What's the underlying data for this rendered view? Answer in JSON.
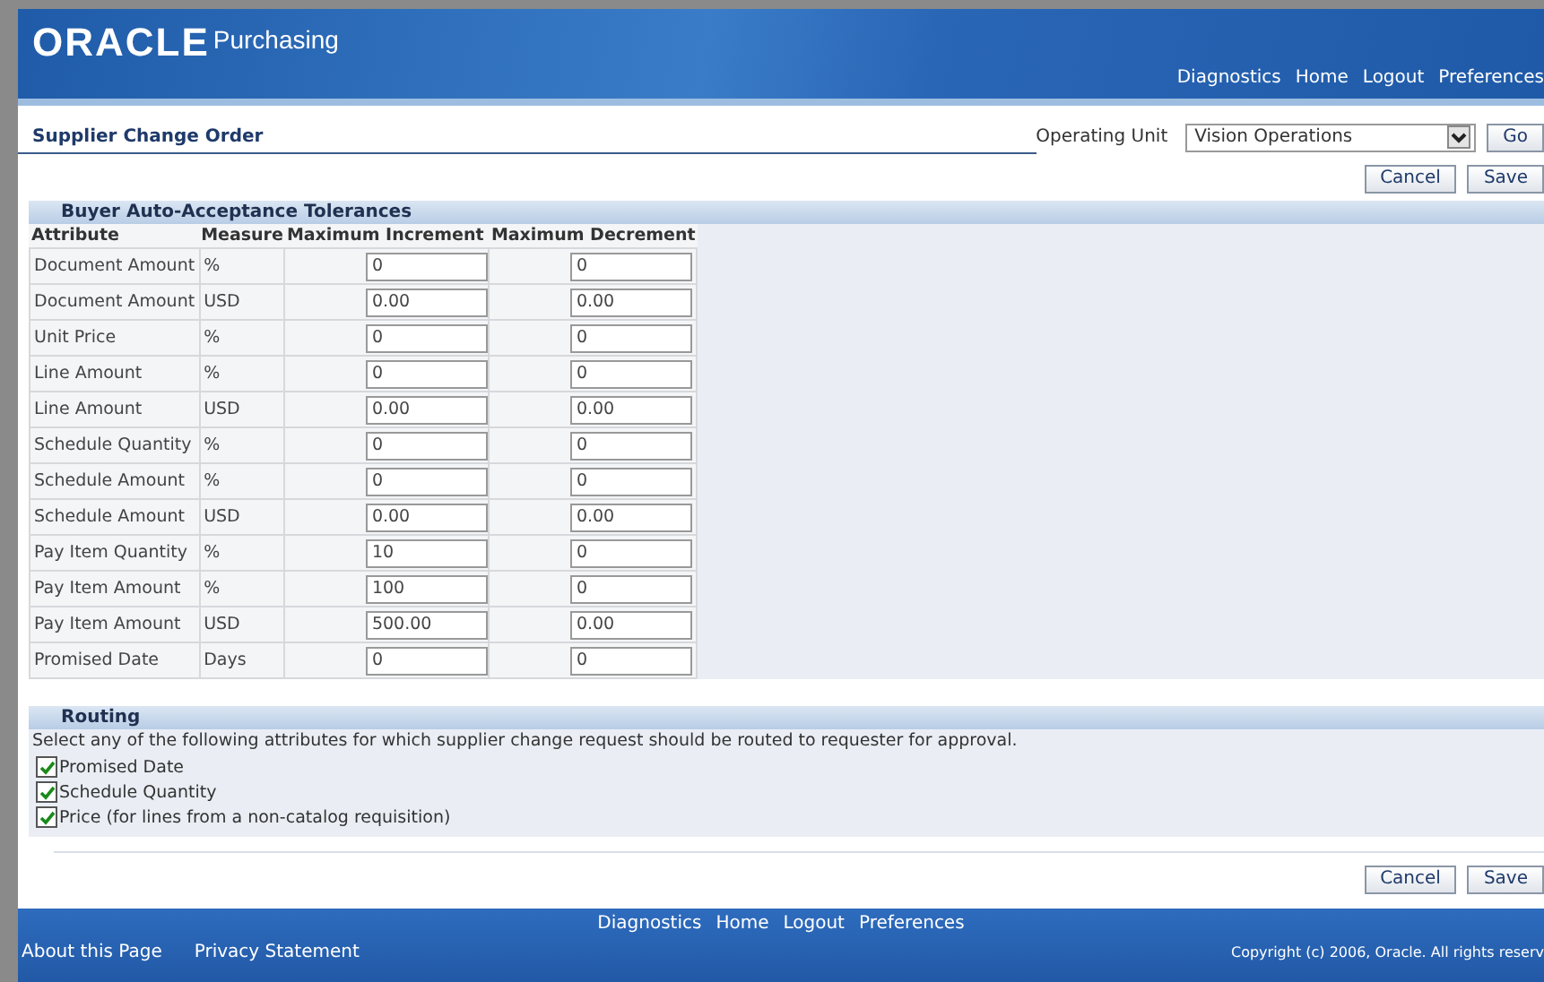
{
  "header": {
    "logo": "ORACLE",
    "product": "Purchasing",
    "links": [
      "Diagnostics",
      "Home",
      "Logout",
      "Preferences"
    ]
  },
  "page": {
    "title": "Supplier Change Order",
    "operating_unit": {
      "label": "Operating Unit",
      "value": "Vision Operations",
      "go": "Go"
    },
    "buttons": [
      "Cancel",
      "Save"
    ]
  },
  "tolerances": {
    "title": "Buyer Auto-Acceptance Tolerances",
    "columns": [
      "Attribute",
      "Measure",
      "Maximum Increment",
      "Maximum Decrement"
    ],
    "rows": [
      {
        "attribute": "Document Amount",
        "measure": "%",
        "increment": "0",
        "decrement": "0"
      },
      {
        "attribute": "Document Amount",
        "measure": "USD",
        "increment": "0.00",
        "decrement": "0.00"
      },
      {
        "attribute": "Unit Price",
        "measure": "%",
        "increment": "0",
        "decrement": "0"
      },
      {
        "attribute": "Line Amount",
        "measure": "%",
        "increment": "0",
        "decrement": "0"
      },
      {
        "attribute": "Line Amount",
        "measure": "USD",
        "increment": "0.00",
        "decrement": "0.00"
      },
      {
        "attribute": "Schedule Quantity",
        "measure": "%",
        "increment": "0",
        "decrement": "0"
      },
      {
        "attribute": "Schedule Amount",
        "measure": "%",
        "increment": "0",
        "decrement": "0"
      },
      {
        "attribute": "Schedule Amount",
        "measure": "USD",
        "increment": "0.00",
        "decrement": "0.00"
      },
      {
        "attribute": "Pay Item Quantity",
        "measure": "%",
        "increment": "10",
        "decrement": "0"
      },
      {
        "attribute": "Pay Item Amount",
        "measure": "%",
        "increment": "100",
        "decrement": "0"
      },
      {
        "attribute": "Pay Item Amount",
        "measure": "USD",
        "increment": "500.00",
        "decrement": "0.00"
      },
      {
        "attribute": "Promised Date",
        "measure": "Days",
        "increment": "0",
        "decrement": "0"
      }
    ]
  },
  "routing": {
    "title": "Routing",
    "instruction": "Select any of the following attributes for which supplier change request should be routed to requester for approval.",
    "options": [
      {
        "label": "Promised Date",
        "checked": true
      },
      {
        "label": "Schedule Quantity",
        "checked": true
      },
      {
        "label": "Price (for lines from a non-catalog requisition)",
        "checked": true
      }
    ]
  },
  "bottom_buttons": [
    "Cancel",
    "Save"
  ],
  "footer": {
    "links": [
      "Diagnostics",
      "Home",
      "Logout",
      "Preferences"
    ],
    "left_links": [
      "About this Page",
      "Privacy Statement"
    ],
    "copyright": "Copyright (c) 2006, Oracle. All rights reserv"
  }
}
